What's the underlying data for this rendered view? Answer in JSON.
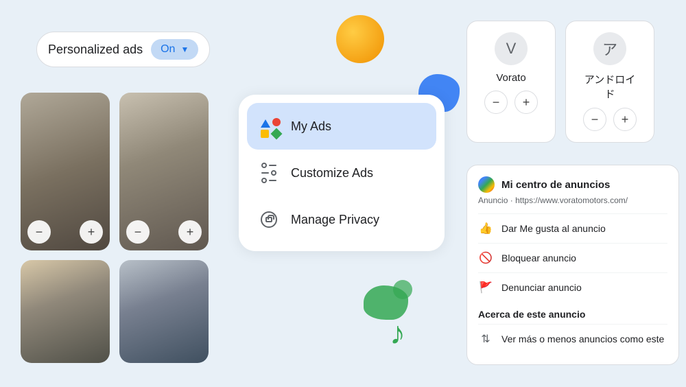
{
  "toggle": {
    "label": "Personalized ads",
    "state": "On"
  },
  "menu": {
    "items": [
      {
        "id": "my-ads",
        "label": "My Ads",
        "active": true
      },
      {
        "id": "customize-ads",
        "label": "Customize Ads",
        "active": false
      },
      {
        "id": "manage-privacy",
        "label": "Manage Privacy",
        "active": false
      }
    ]
  },
  "brand_cards": [
    {
      "id": "vorato",
      "initial": "V",
      "name": "Vorato"
    },
    {
      "id": "android",
      "initial": "ア",
      "name": "アンドロイド"
    }
  ],
  "ad_center": {
    "title": "Mi centro de anuncios",
    "ad_label": "Anuncio",
    "url": "https://www.voratomotors.com/",
    "actions": [
      {
        "id": "like",
        "label": "Dar Me gusta al anuncio"
      },
      {
        "id": "block",
        "label": "Bloquear anuncio"
      },
      {
        "id": "report",
        "label": "Denunciar anuncio"
      }
    ],
    "about_title": "Acerca de este anuncio",
    "about_action": "Ver más o menos anuncios como este"
  },
  "controls": {
    "minus": "−",
    "plus": "+"
  }
}
